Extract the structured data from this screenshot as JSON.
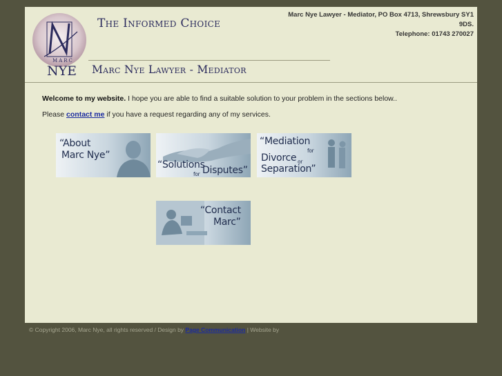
{
  "header": {
    "logo_text_top": "MARC",
    "logo_letter": "N",
    "logo_text_bottom": "NYE",
    "tagline": "The Informed Choice",
    "title": "Marc Nye Lawyer - Mediator",
    "address": "Marc Nye Lawyer - Mediator, PO Box 4713, Shrewsbury SY1 9DS.",
    "telephone": "Telephone: 01743 270027"
  },
  "main": {
    "welcome_bold": "Welcome to my website.",
    "welcome_text": " I hope you are able to find a suitable solution to your problem in the sections below..",
    "please_prefix": "Please ",
    "contact_link": "contact me",
    "please_suffix": " if you have a request regarding any of my services."
  },
  "tiles": {
    "about": {
      "line1": "“About",
      "line2": "Marc Nye”"
    },
    "solutions": {
      "word1": "“Solutions",
      "small": "for",
      "word2": "Disputes”"
    },
    "mediation": {
      "line1": "“Mediation",
      "small1": "for",
      "line2": "Divorce",
      "small2": "or",
      "line3": "Separation”"
    },
    "contact": {
      "line1": "“Contact",
      "line2": "Marc”"
    }
  },
  "footer": {
    "copyright": "© Copyright 2006, Marc Nye, all rights reserved / Design by ",
    "design_link": "Page Communication",
    "website_by": " | Website by"
  },
  "colors": {
    "background": "#53533f",
    "page": "#e9ead2",
    "heading": "#2a2a5c",
    "link": "#1a2aa0"
  }
}
